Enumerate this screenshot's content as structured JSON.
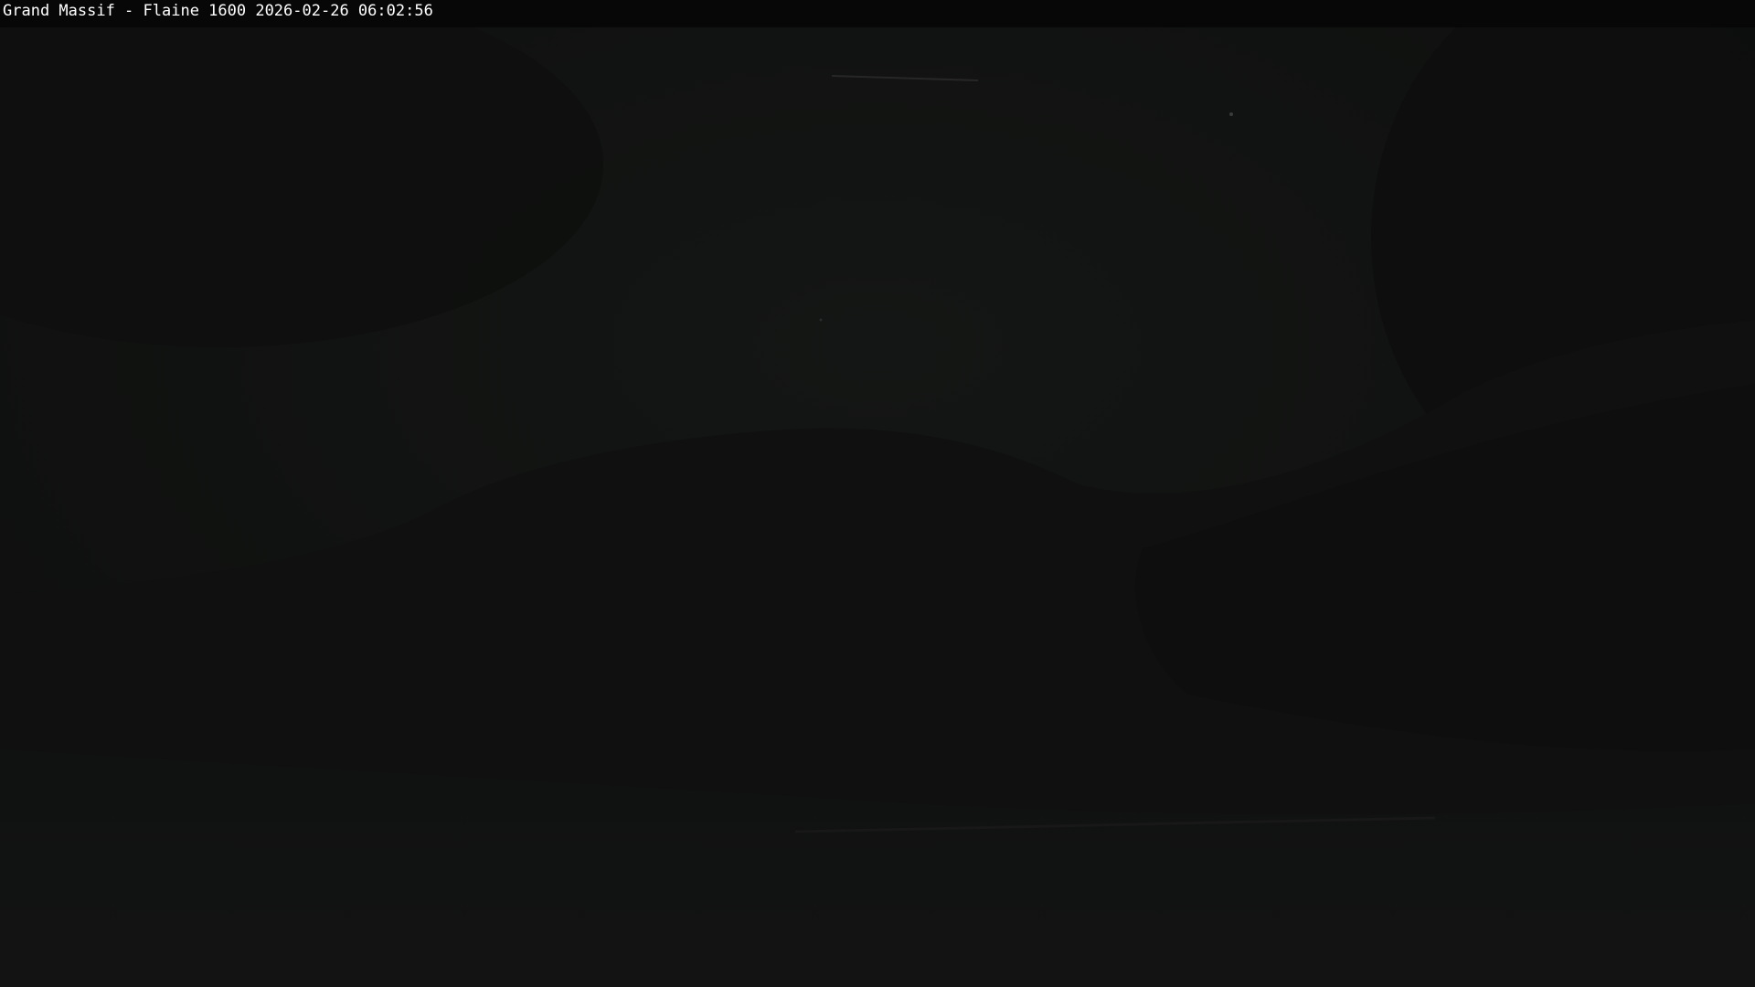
{
  "overlay": {
    "caption": "Grand Massif - Flaine 1600 2026-02-26 06:02:56"
  },
  "colors": {
    "sky": "#121413",
    "ridge": "#0f1110",
    "foreground": "#101211",
    "overlay_bar": "#070707",
    "overlay_text": "#ffffff"
  }
}
